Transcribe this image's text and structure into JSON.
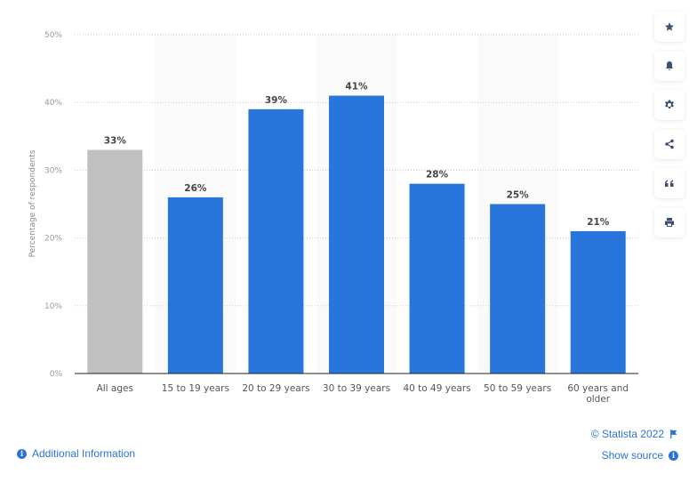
{
  "chart_data": {
    "type": "bar",
    "title": "",
    "xlabel": "",
    "ylabel": "Percentage of respondents",
    "ylim": [
      0,
      50
    ],
    "yticks": [
      "0%",
      "10%",
      "20%",
      "30%",
      "40%",
      "50%"
    ],
    "ytick_values": [
      0,
      10,
      20,
      30,
      40,
      50
    ],
    "grid": true,
    "categories": [
      "All ages",
      "15 to 19 years",
      "20 to 29 years",
      "30 to 39 years",
      "40 to 49 years",
      "50 to 59 years",
      "60 years and older"
    ],
    "category_lines": [
      [
        "All ages"
      ],
      [
        "15 to 19 years"
      ],
      [
        "20 to 29 years"
      ],
      [
        "30 to 39 years"
      ],
      [
        "40 to 49 years"
      ],
      [
        "50 to 59 years"
      ],
      [
        "60 years and",
        "older"
      ]
    ],
    "values": [
      33,
      26,
      39,
      41,
      28,
      25,
      21
    ],
    "labels": [
      "33%",
      "26%",
      "39%",
      "41%",
      "28%",
      "25%",
      "21%"
    ],
    "colors": [
      "#c0c0c0",
      "#2875db",
      "#2875db",
      "#2875db",
      "#2875db",
      "#2875db",
      "#2875db"
    ]
  },
  "sidebar": {
    "buttons": [
      {
        "name": "favorite-button",
        "icon": "star-icon"
      },
      {
        "name": "notification-button",
        "icon": "bell-icon"
      },
      {
        "name": "settings-button",
        "icon": "gear-icon"
      },
      {
        "name": "share-button",
        "icon": "share-icon"
      },
      {
        "name": "cite-button",
        "icon": "quote-icon"
      },
      {
        "name": "print-button",
        "icon": "print-icon"
      }
    ]
  },
  "footer": {
    "additional_info": "Additional Information",
    "copyright": "© Statista 2022",
    "show_source": "Show source"
  }
}
